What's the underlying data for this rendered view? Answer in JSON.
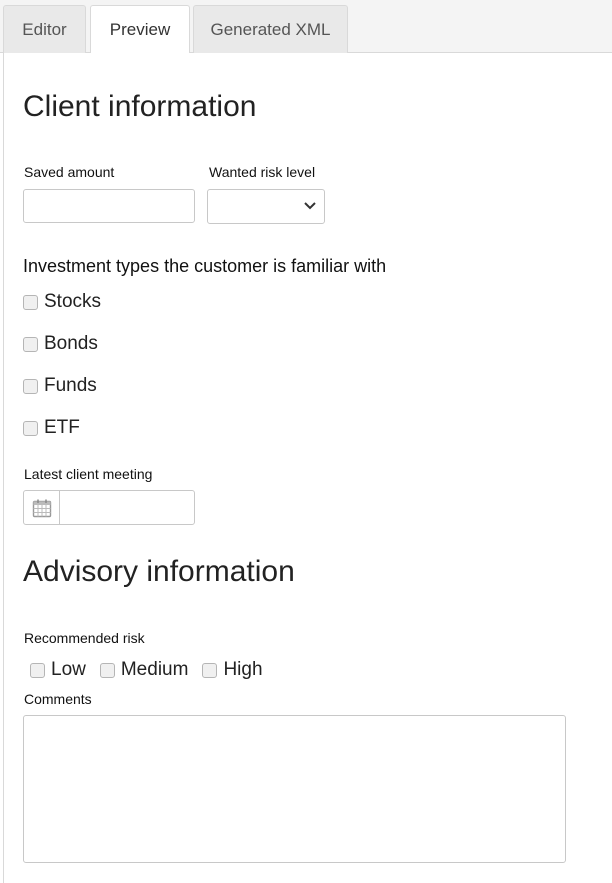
{
  "tabs": [
    {
      "label": "Editor",
      "active": false
    },
    {
      "label": "Preview",
      "active": true
    },
    {
      "label": "Generated XML",
      "active": false
    }
  ],
  "client_section": {
    "title": "Client information",
    "saved_amount": {
      "label": "Saved amount",
      "value": ""
    },
    "risk_level": {
      "label": "Wanted risk level",
      "value": ""
    },
    "investment_types": {
      "title": "Investment types the customer is familiar with",
      "options": [
        {
          "label": "Stocks",
          "checked": false
        },
        {
          "label": "Bonds",
          "checked": false
        },
        {
          "label": "Funds",
          "checked": false
        },
        {
          "label": "ETF",
          "checked": false
        }
      ]
    },
    "latest_meeting": {
      "label": "Latest client meeting",
      "value": ""
    }
  },
  "advisory_section": {
    "title": "Advisory information",
    "recommended_risk": {
      "label": "Recommended risk",
      "options": [
        {
          "label": "Low",
          "checked": false
        },
        {
          "label": "Medium",
          "checked": false
        },
        {
          "label": "High",
          "checked": false
        }
      ]
    },
    "comments": {
      "label": "Comments",
      "value": ""
    }
  },
  "icons": {
    "calendar": "calendar-icon",
    "select_arrow": "chevron-down-icon"
  },
  "colors": {
    "border": "#c8c8c8",
    "tab_bg": "#e9e9e9",
    "tab_active_bg": "#ffffff"
  }
}
